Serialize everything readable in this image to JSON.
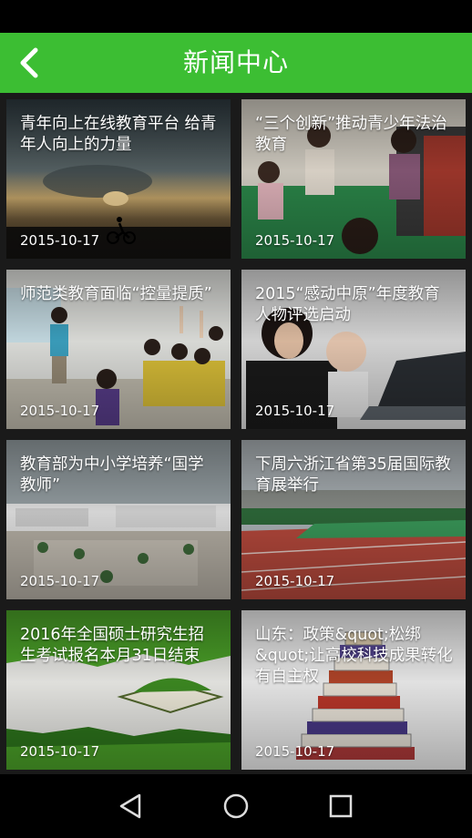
{
  "header": {
    "title": "新闻中心",
    "back_icon": "chevron-left-icon"
  },
  "colors": {
    "accent": "#3cbe33",
    "background": "#1a1a1a"
  },
  "news": [
    {
      "title": "青年向上在线教育平台 给青年人向上的力量",
      "date": "2015-10-17"
    },
    {
      "title": "“三个创新”推动青少年法治教育",
      "date": "2015-10-17"
    },
    {
      "title": "师范类教育面临“控量提质”",
      "date": "2015-10-17"
    },
    {
      "title": "2015“感动中原”年度教育人物评选启动",
      "date": "2015-10-17"
    },
    {
      "title": "教育部为中小学培养“国学教师”",
      "date": "2015-10-17"
    },
    {
      "title": "下周六浙江省第35届国际教育展举行",
      "date": "2015-10-17"
    },
    {
      "title": "2016年全国硕士研究生招生考试报名本月31日结束",
      "date": "2015-10-17"
    },
    {
      "title": "山东：政策&quot;松绑&quot;让高校科技成果转化有自主权",
      "date": "2015-10-17"
    }
  ],
  "nav": {
    "back": "back-triangle-icon",
    "home": "home-circle-icon",
    "recents": "recents-square-icon"
  }
}
